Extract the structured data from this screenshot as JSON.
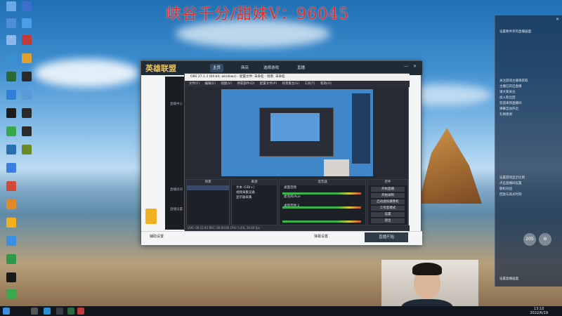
{
  "watermark": "峡谷千分/甜妹V：96045",
  "lol": {
    "logo": "英雄联盟",
    "tabs": [
      "主页",
      "商店",
      "选择游戏",
      "直播"
    ],
    "sidebar": [
      "直播中心",
      "直播房间",
      "直播设置"
    ],
    "footer_left": "辅助设置",
    "footer_mid": "弹幕设置",
    "accept": "直播开始"
  },
  "obs": {
    "title": "OBS 27.1.3 (64-bit, windows) - 配置文件: 未命名 - 场景: 未命名",
    "menu": [
      "文件(F)",
      "编辑(E)",
      "视图(V)",
      "停靠部件(D)",
      "配置文件(P)",
      "场景集合(S)",
      "工具(T)",
      "帮助(H)"
    ],
    "docks": {
      "scenes": "场景",
      "sources": "来源",
      "mixer": "混音器",
      "controls": "控件"
    },
    "sources_items": [
      "文本 (GDI+)",
      "视频采集设备",
      "显示器采集"
    ],
    "mixer_items": [
      "桌面音频",
      "麦克风/Aux",
      "桌面音频 2"
    ],
    "controls_items": [
      "开始直播",
      "开始录制",
      "启动虚拟摄像机",
      "工作室模式",
      "设置",
      "退出"
    ],
    "status": "LIVE: 00:12:45   REC: 00:00:00   CPU: 5.4%, 30.00 fps"
  },
  "notify": {
    "lines": [
      "设置要共享的直播画面",
      "关注游戏主播来获取",
      "主播已开启直播",
      "请大家关注",
      "加入粉丝团",
      "欢迎来到直播间",
      "弹幕互动开启",
      "礼物感谢",
      "设置游戏显示比例",
      "点击直播间设置",
      "联机对战",
      "回放与高光时刻"
    ],
    "footer": "设置直播画面",
    "quick_a": "205",
    "quick_b": "⚙"
  },
  "clock": {
    "time": "13:10",
    "date": "2022/6/19"
  },
  "colors": {
    "watermark": "#e0302a",
    "obs_bg": "#272a33",
    "lol_bar": "#1f2b35"
  }
}
